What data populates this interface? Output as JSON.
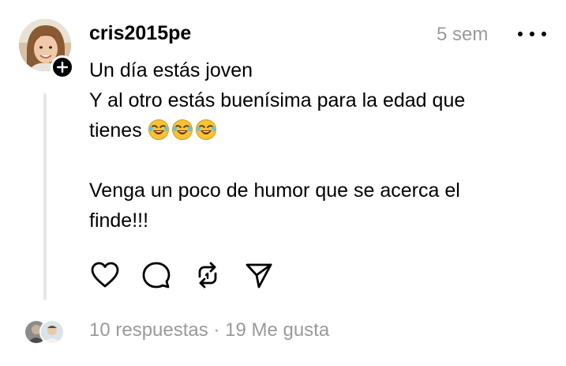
{
  "post": {
    "username": "cris2015pe",
    "timestamp": "5 sem",
    "lines": {
      "line1": "Un día estás joven",
      "line2": "Y al otro estás buenísima para la edad que",
      "line3": "tienes",
      "line4": "Venga un poco de humor que se acerca el",
      "line5": "finde!!!"
    },
    "emojis": [
      "rofl-emoji",
      "rofl-emoji",
      "rofl-emoji"
    ]
  },
  "actions": [
    "like-icon",
    "comment-icon",
    "repost-icon",
    "share-icon"
  ],
  "stats": {
    "replies": "10 respuestas",
    "separator": " · ",
    "likes": "19 Me gusta"
  },
  "colors": {
    "text": "#000000",
    "muted": "#9a9a9a",
    "thread_line": "#e6e6e6",
    "emoji_face": "#f7c335"
  }
}
